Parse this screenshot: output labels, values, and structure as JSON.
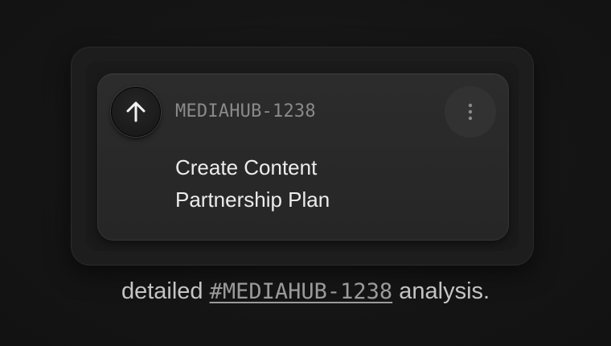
{
  "card": {
    "issue_id": "MEDIAHUB-1238",
    "title": "Create Content Partnership Plan",
    "upvote_icon": "arrow-up-icon",
    "menu_icon": "vertical-dots-icon"
  },
  "caption": {
    "before": "detailed",
    "link_text": "#MEDIAHUB-1238",
    "after": "analysis."
  },
  "colors": {
    "background": "#141414",
    "card": "#2a2a2a",
    "text_primary": "#ececec",
    "text_muted": "#8a8a8a"
  }
}
